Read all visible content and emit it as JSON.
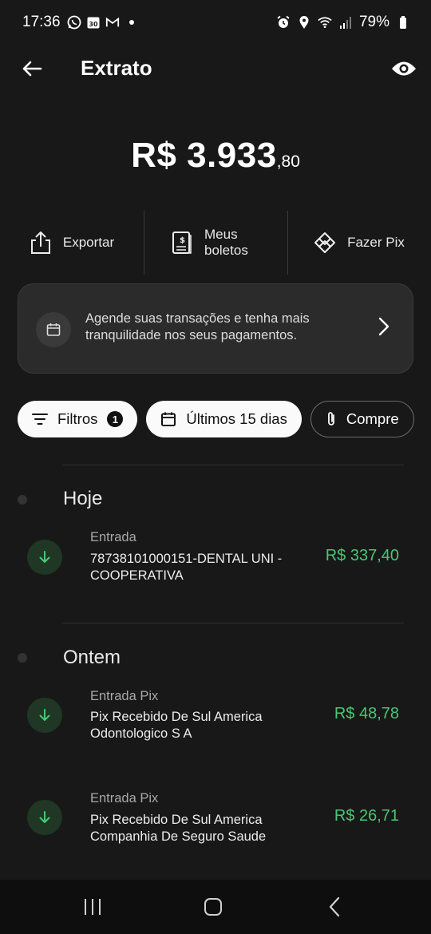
{
  "status_bar": {
    "time": "17:36",
    "left_icons": [
      "whatsapp-icon",
      "calendar-icon",
      "gmail-icon",
      "dot-icon"
    ],
    "calendar_day": "30",
    "right_icons": [
      "alarm-icon",
      "location-icon",
      "wifi-icon",
      "signal-icon",
      "battery-icon"
    ],
    "battery": "79%"
  },
  "header": {
    "title": "Extrato",
    "back_icon": "arrow-left-icon",
    "visibility_icon": "eye-icon"
  },
  "balance": {
    "main": "R$ 3.933",
    "cents": ",80"
  },
  "actions": [
    {
      "label": "Exportar",
      "icon": "export-icon"
    },
    {
      "label": "Meus boletos",
      "icon": "boleto-icon"
    },
    {
      "label": "Fazer Pix",
      "icon": "pix-icon"
    }
  ],
  "banner": {
    "text": "Agende suas transações e tenha mais tranquilidade nos seus pagamentos.",
    "icon": "calendar-icon",
    "chevron": "chevron-right-icon"
  },
  "chips": {
    "filters_label": "Filtros",
    "filters_count": "1",
    "period_label": "Últimos 15 dias",
    "receipts_label": "Compre"
  },
  "sections": [
    {
      "title": "Hoje",
      "transactions": [
        {
          "type": "Entrada",
          "description": "78738101000151-DENTAL UNI - COOPERATIVA",
          "amount": "R$ 337,40"
        }
      ]
    },
    {
      "title": "Ontem",
      "transactions": [
        {
          "type": "Entrada Pix",
          "description": "Pix Recebido De Sul America Odontologico S A",
          "amount": "R$ 48,78"
        },
        {
          "type": "Entrada Pix",
          "description": "Pix Recebido De Sul America Companhia De Seguro Saude",
          "amount": "R$ 26,71"
        }
      ]
    }
  ],
  "colors": {
    "background": "#181818",
    "positive_amount": "#48c774",
    "card": "#2b2b2b"
  }
}
